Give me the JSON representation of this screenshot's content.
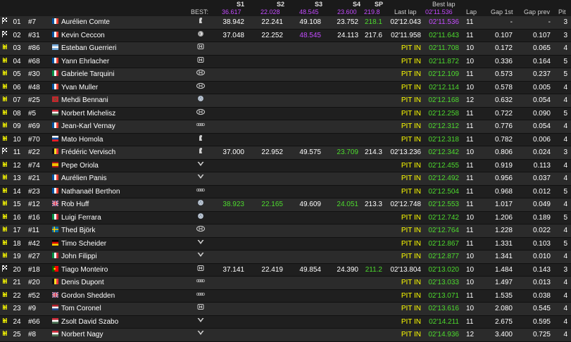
{
  "header": {
    "best_label": "BEST:",
    "cols": {
      "s1": "S1",
      "s2": "S2",
      "s3": "S3",
      "s4": "S4",
      "sp": "SP",
      "last_lap": "Last lap",
      "best_lap": "Best lap",
      "lap": "Lap",
      "gap_first": "Gap 1st",
      "gap_prev": "Gap prev",
      "pit": "Pit"
    },
    "best": {
      "s1": "36.617",
      "s2": "22.028",
      "s3": "48.545",
      "s4": "23.600",
      "sp": "219.8",
      "best_lap": "02'11.536"
    }
  },
  "colors": {
    "pit_text": "#ffff00",
    "personal_best": "#4ddb2e",
    "overall_best": "#c44bff",
    "row_odd": "#2b2b2b",
    "row_even": "#1f1f1f"
  },
  "rows": [
    {
      "status": "finish",
      "pos": "01",
      "num": "#7",
      "country": "FR",
      "name": "Aurélien Comte",
      "team_icon": "peugeot-icon",
      "s1": "38.942",
      "s2": "22.241",
      "s3": "49.108",
      "s4": "23.752",
      "sp": "218.1",
      "sp_c": "green",
      "last": "02'12.043",
      "best": "02'11.536",
      "best_c": "purple",
      "lap": "11",
      "gap1": "-",
      "gapp": "-",
      "pits": "3"
    },
    {
      "status": "finish",
      "pos": "02",
      "num": "#31",
      "country": "FR",
      "name": "Kevin Ceccon",
      "team_icon": "alfa-icon",
      "s1": "37.048",
      "s2": "22.252",
      "s3": "48.545",
      "s3_c": "purple",
      "s4": "24.113",
      "sp": "217.6",
      "last": "02'11.958",
      "best": "02'11.643",
      "best_c": "green",
      "lap": "11",
      "gap1": "0.107",
      "gapp": "0.107",
      "pits": "3"
    },
    {
      "status": "pit",
      "pos": "03",
      "num": "#86",
      "country": "AR",
      "name": "Esteban Guerrieri",
      "team_icon": "honda-icon",
      "s1": "",
      "s2": "",
      "s3": "",
      "s4": "",
      "sp": "",
      "last": "PIT IN",
      "best": "02'11.708",
      "best_c": "green",
      "lap": "10",
      "gap1": "0.172",
      "gapp": "0.065",
      "pits": "4"
    },
    {
      "status": "pit",
      "pos": "04",
      "num": "#68",
      "country": "FR",
      "name": "Yann Ehrlacher",
      "team_icon": "honda-icon",
      "s1": "",
      "s2": "",
      "s3": "",
      "s4": "",
      "sp": "",
      "last": "PIT IN",
      "best": "02'11.872",
      "best_c": "green",
      "lap": "10",
      "gap1": "0.336",
      "gapp": "0.164",
      "pits": "5"
    },
    {
      "status": "pit",
      "pos": "05",
      "num": "#30",
      "country": "IT",
      "name": "Gabriele Tarquini",
      "team_icon": "hyundai-icon",
      "s1": "",
      "s2": "",
      "s3": "",
      "s4": "",
      "sp": "",
      "last": "PIT IN",
      "best": "02'12.109",
      "best_c": "green",
      "lap": "11",
      "gap1": "0.573",
      "gapp": "0.237",
      "pits": "5"
    },
    {
      "status": "pit",
      "pos": "06",
      "num": "#48",
      "country": "FR",
      "name": "Yvan Muller",
      "team_icon": "hyundai-icon",
      "s1": "",
      "s2": "",
      "s3": "",
      "s4": "",
      "sp": "",
      "last": "PIT IN",
      "best": "02'12.114",
      "best_c": "green",
      "lap": "10",
      "gap1": "0.578",
      "gapp": "0.005",
      "pits": "4"
    },
    {
      "status": "pit",
      "pos": "07",
      "num": "#25",
      "country": "MA",
      "name": "Mehdi Bennani",
      "team_icon": "vw-icon",
      "s1": "",
      "s2": "",
      "s3": "",
      "s4": "",
      "sp": "",
      "last": "PIT IN",
      "best": "02'12.168",
      "best_c": "green",
      "lap": "12",
      "gap1": "0.632",
      "gapp": "0.054",
      "pits": "4"
    },
    {
      "status": "pit",
      "pos": "08",
      "num": "#5",
      "country": "HU",
      "name": "Norbert Michelisz",
      "team_icon": "hyundai-icon",
      "s1": "",
      "s2": "",
      "s3": "",
      "s4": "",
      "sp": "",
      "last": "PIT IN",
      "best": "02'12.258",
      "best_c": "green",
      "lap": "11",
      "gap1": "0.722",
      "gapp": "0.090",
      "pits": "5"
    },
    {
      "status": "pit",
      "pos": "09",
      "num": "#69",
      "country": "FR",
      "name": "Jean-Karl Vernay",
      "team_icon": "audi-icon",
      "s1": "",
      "s2": "",
      "s3": "",
      "s4": "",
      "sp": "",
      "last": "PIT IN",
      "best": "02'12.312",
      "best_c": "green",
      "lap": "11",
      "gap1": "0.776",
      "gapp": "0.054",
      "pits": "4"
    },
    {
      "status": "pit",
      "pos": "10",
      "num": "#70",
      "country": "SK",
      "name": "Mato Homola",
      "team_icon": "peugeot-icon",
      "s1": "",
      "s2": "",
      "s3": "",
      "s4": "",
      "sp": "",
      "last": "PIT IN",
      "best": "02'12.318",
      "best_c": "green",
      "lap": "11",
      "gap1": "0.782",
      "gapp": "0.006",
      "pits": "4"
    },
    {
      "status": "finish",
      "pos": "11",
      "num": "#22",
      "country": "BE",
      "name": "Frédéric Vervisch",
      "team_icon": "peugeot-icon",
      "s1": "37.000",
      "s2": "22.952",
      "s3": "49.575",
      "s4": "23.709",
      "s4_c": "green",
      "sp": "214.3",
      "last": "02'13.236",
      "best": "02'12.342",
      "best_c": "green",
      "lap": "10",
      "gap1": "0.806",
      "gapp": "0.024",
      "pits": "3"
    },
    {
      "status": "pit",
      "pos": "12",
      "num": "#74",
      "country": "ES",
      "name": "Pepe Oriola",
      "team_icon": "cupra-icon",
      "s1": "",
      "s2": "",
      "s3": "",
      "s4": "",
      "sp": "",
      "last": "PIT IN",
      "best": "02'12.455",
      "best_c": "green",
      "lap": "11",
      "gap1": "0.919",
      "gapp": "0.113",
      "pits": "4"
    },
    {
      "status": "pit",
      "pos": "13",
      "num": "#21",
      "country": "FR",
      "name": "Aurélien Panis",
      "team_icon": "cupra-icon",
      "s1": "",
      "s2": "",
      "s3": "",
      "s4": "",
      "sp": "",
      "last": "PIT IN",
      "best": "02'12.492",
      "best_c": "green",
      "lap": "11",
      "gap1": "0.956",
      "gapp": "0.037",
      "pits": "4"
    },
    {
      "status": "pit",
      "pos": "14",
      "num": "#23",
      "country": "FR",
      "name": "Nathanaël Berthon",
      "team_icon": "audi-icon",
      "s1": "",
      "s2": "",
      "s3": "",
      "s4": "",
      "sp": "",
      "last": "PIT IN",
      "best": "02'12.504",
      "best_c": "green",
      "lap": "11",
      "gap1": "0.968",
      "gapp": "0.012",
      "pits": "5"
    },
    {
      "status": "pit",
      "pos": "15",
      "num": "#12",
      "country": "GB",
      "name": "Rob Huff",
      "team_icon": "vw-icon",
      "s1": "38.923",
      "s1_c": "green",
      "s2": "22.165",
      "s2_c": "green",
      "s3": "49.609",
      "s4": "24.051",
      "s4_c": "green",
      "sp": "213.3",
      "last": "02'12.748",
      "best": "02'12.553",
      "best_c": "green",
      "lap": "11",
      "gap1": "1.017",
      "gapp": "0.049",
      "pits": "4"
    },
    {
      "status": "pit",
      "pos": "16",
      "num": "#16",
      "country": "IT",
      "name": "Luigi Ferrara",
      "team_icon": "vw-icon",
      "s1": "",
      "s2": "",
      "s3": "",
      "s4": "",
      "sp": "",
      "last": "PIT IN",
      "best": "02'12.742",
      "best_c": "green",
      "lap": "10",
      "gap1": "1.206",
      "gapp": "0.189",
      "pits": "5"
    },
    {
      "status": "pit",
      "pos": "17",
      "num": "#11",
      "country": "SE",
      "name": "Thed Björk",
      "team_icon": "hyundai-icon",
      "s1": "",
      "s2": "",
      "s3": "",
      "s4": "",
      "sp": "",
      "last": "PIT IN",
      "best": "02'12.764",
      "best_c": "green",
      "lap": "11",
      "gap1": "1.228",
      "gapp": "0.022",
      "pits": "4"
    },
    {
      "status": "pit",
      "pos": "18",
      "num": "#42",
      "country": "DE",
      "name": "Timo Scheider",
      "team_icon": "cupra-icon",
      "s1": "",
      "s2": "",
      "s3": "",
      "s4": "",
      "sp": "",
      "last": "PIT IN",
      "best": "02'12.867",
      "best_c": "green",
      "lap": "11",
      "gap1": "1.331",
      "gapp": "0.103",
      "pits": "5"
    },
    {
      "status": "pit",
      "pos": "19",
      "num": "#27",
      "country": "IT",
      "name": "John Filippi",
      "team_icon": "cupra-icon",
      "s1": "",
      "s2": "",
      "s3": "",
      "s4": "",
      "sp": "",
      "last": "PIT IN",
      "best": "02'12.877",
      "best_c": "green",
      "lap": "10",
      "gap1": "1.341",
      "gapp": "0.010",
      "pits": "4"
    },
    {
      "status": "finish",
      "pos": "20",
      "num": "#18",
      "country": "PT",
      "name": "Tiago Monteiro",
      "team_icon": "honda-icon",
      "s1": "37.141",
      "s2": "22.419",
      "s3": "49.854",
      "s4": "24.390",
      "sp": "211.2",
      "sp_c": "green",
      "last": "02'13.804",
      "best": "02'13.020",
      "best_c": "green",
      "lap": "10",
      "gap1": "1.484",
      "gapp": "0.143",
      "pits": "3"
    },
    {
      "status": "pit",
      "pos": "21",
      "num": "#20",
      "country": "BE",
      "name": "Denis Dupont",
      "team_icon": "audi-icon",
      "s1": "",
      "s2": "",
      "s3": "",
      "s4": "",
      "sp": "",
      "last": "PIT IN",
      "best": "02'13.033",
      "best_c": "green",
      "lap": "10",
      "gap1": "1.497",
      "gapp": "0.013",
      "pits": "4"
    },
    {
      "status": "pit",
      "pos": "22",
      "num": "#52",
      "country": "GB",
      "name": "Gordon Shedden",
      "team_icon": "audi-icon",
      "s1": "",
      "s2": "",
      "s3": "",
      "s4": "",
      "sp": "",
      "last": "PIT IN",
      "best": "02'13.071",
      "best_c": "green",
      "lap": "11",
      "gap1": "1.535",
      "gapp": "0.038",
      "pits": "4"
    },
    {
      "status": "pit",
      "pos": "23",
      "num": "#9",
      "country": "NL",
      "name": "Tom Coronel",
      "team_icon": "honda-icon",
      "s1": "",
      "s2": "",
      "s3": "",
      "s4": "",
      "sp": "",
      "last": "PIT IN",
      "best": "02'13.616",
      "best_c": "green",
      "lap": "10",
      "gap1": "2.080",
      "gapp": "0.545",
      "pits": "4"
    },
    {
      "status": "pit",
      "pos": "24",
      "num": "#66",
      "country": "HU",
      "name": "Zsolt David Szabo",
      "team_icon": "cupra-icon",
      "s1": "",
      "s2": "",
      "s3": "",
      "s4": "",
      "sp": "",
      "last": "PIT IN",
      "best": "02'14.211",
      "best_c": "green",
      "lap": "11",
      "gap1": "2.675",
      "gapp": "0.595",
      "pits": "4"
    },
    {
      "status": "pit",
      "pos": "25",
      "num": "#8",
      "country": "HU",
      "name": "Norbert Nagy",
      "team_icon": "cupra-icon",
      "s1": "",
      "s2": "",
      "s3": "",
      "s4": "",
      "sp": "",
      "last": "PIT IN",
      "best": "02'14.936",
      "best_c": "green",
      "lap": "12",
      "gap1": "3.400",
      "gapp": "0.725",
      "pits": "4"
    }
  ]
}
